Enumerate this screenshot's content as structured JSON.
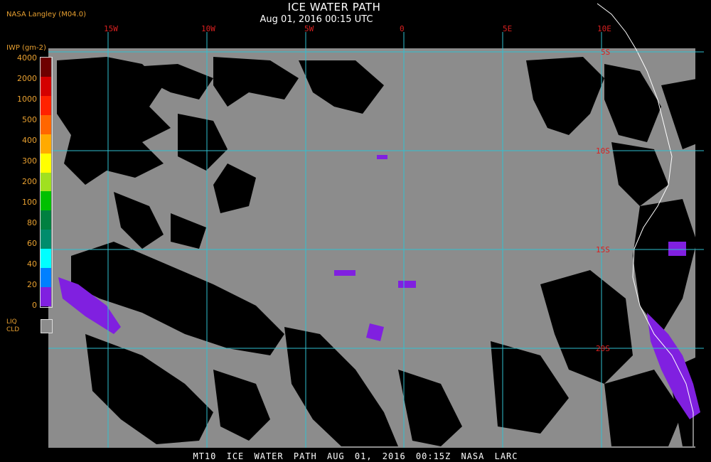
{
  "header": {
    "title": "ICE WATER PATH",
    "subtitle": "Aug 01, 2016 00:15 UTC",
    "credit": "NASA Langley (M04.0)"
  },
  "legend": {
    "unit_label": "IWP (gm-2)",
    "levels": [
      {
        "label": "4000",
        "color": "#6e0000"
      },
      {
        "label": "2000",
        "color": "#d40000"
      },
      {
        "label": "1000",
        "color": "#ff2200"
      },
      {
        "label": "500",
        "color": "#ff6600"
      },
      {
        "label": "400",
        "color": "#ffaa00"
      },
      {
        "label": "300",
        "color": "#ffff00"
      },
      {
        "label": "200",
        "color": "#a0e020"
      },
      {
        "label": "100",
        "color": "#00c000"
      },
      {
        "label": "80",
        "color": "#008040"
      },
      {
        "label": "60",
        "color": "#008c6c"
      },
      {
        "label": "40",
        "color": "#00ffff"
      },
      {
        "label": "20",
        "color": "#0080ff"
      },
      {
        "label": "0",
        "color": "#0000ff"
      }
    ],
    "zero_color": "#8020e0",
    "liquid_label_1": "LIQ",
    "liquid_label_2": "CLD",
    "liquid_color": "#8c8c8c"
  },
  "map": {
    "lon_labels": [
      "15W",
      "10W",
      "5W",
      "0",
      "5E",
      "10E"
    ],
    "lat_labels": [
      "5S",
      "10S",
      "15S",
      "20S"
    ],
    "grid_color": "#30c0d0",
    "label_color": "#d82020",
    "liquid_cloud_color": "#8c8c8c",
    "clear_color": "#000000",
    "ice_color": "#8020e0"
  },
  "footer": {
    "text": "MT10  ICE WATER PATH  AUG 01, 2016 00:15Z  NASA LARC"
  }
}
